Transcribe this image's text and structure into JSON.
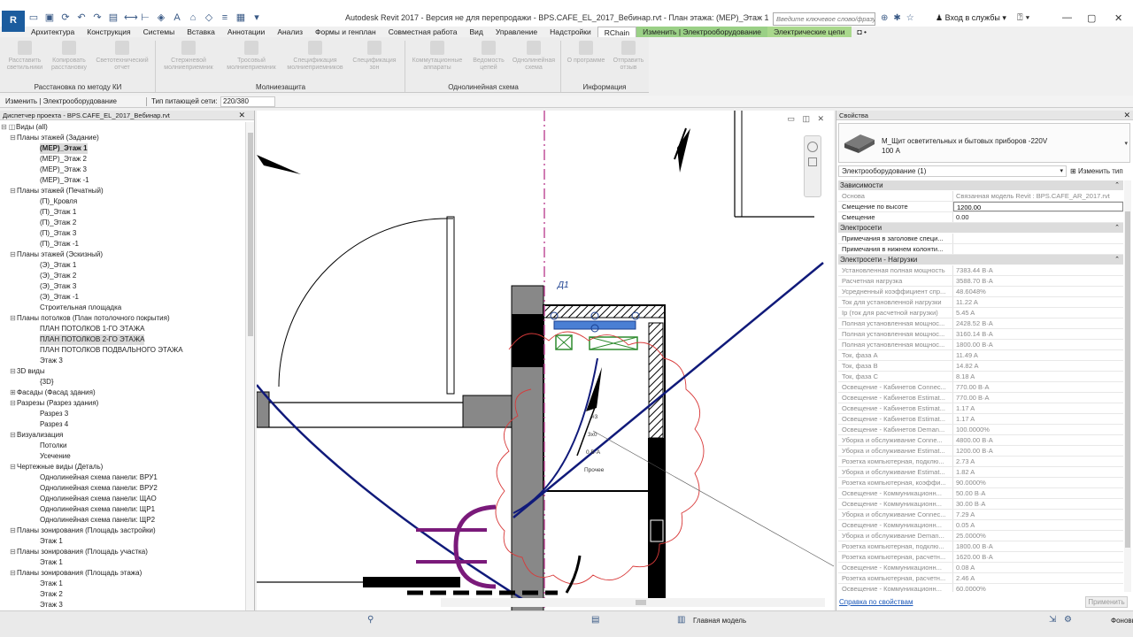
{
  "app": {
    "logo": "R",
    "title": "Autodesk Revit 2017 - Версия не для перепродажи -    BPS.CAFE_EL_2017_Вебинар.rvt - План этажа: (MEP)_Этаж 1",
    "search_placeholder": "Введите ключевое слово/фразу",
    "login": "Вход в службы",
    "quick_access_icons": [
      "open-icon",
      "save-icon",
      "sync-icon",
      "undo-icon",
      "redo-icon",
      "print-icon",
      "measure-icon",
      "dimension-icon",
      "tag-icon",
      "text-icon",
      "3d-icon",
      "section-icon",
      "thin-lines-icon",
      "close-hidden-icon",
      "switch-windows-icon"
    ]
  },
  "tabs": [
    {
      "label": "Архитектура"
    },
    {
      "label": "Конструкция"
    },
    {
      "label": "Системы"
    },
    {
      "label": "Вставка"
    },
    {
      "label": "Аннотации"
    },
    {
      "label": "Анализ"
    },
    {
      "label": "Формы и генплан"
    },
    {
      "label": "Совместная работа"
    },
    {
      "label": "Вид"
    },
    {
      "label": "Управление"
    },
    {
      "label": "Надстройки"
    },
    {
      "label": "RChain"
    },
    {
      "label": "Изменить | Электрооборудование"
    },
    {
      "label": "Электрические цепи"
    },
    {
      "label": "◘ •"
    }
  ],
  "ribbon": {
    "buttons": [
      {
        "label": "Расставить светильники"
      },
      {
        "label": "Копировать расстановку"
      },
      {
        "label": "Светотехнический отчет"
      },
      {
        "label": "Стержневой молниеприемник"
      },
      {
        "label": "Тросовый молниеприемник"
      },
      {
        "label": "Спецификация молниеприемников"
      },
      {
        "label": "Спецификация зон"
      },
      {
        "label": "Коммутационные аппараты"
      },
      {
        "label": "Ведомость цепей"
      },
      {
        "label": "Однолинейная схема"
      },
      {
        "label": "О программе"
      },
      {
        "label": "Отправить отзыв"
      }
    ],
    "groups": [
      {
        "label": "Расстановка по методу КИ"
      },
      {
        "label": "Молниезащита"
      },
      {
        "label": "Однолинейная схема"
      },
      {
        "label": "Информация"
      }
    ]
  },
  "context_bar": {
    "mode_label": "Изменить | Электрооборудование",
    "network_label": "Тип питающей сети:",
    "network_value": "220/380"
  },
  "project_browser": {
    "title": "Диспетчер проекта - BPS.CAFE_EL_2017_Вебинар.rvt",
    "close": "✕",
    "items": [
      {
        "label": "Виды (all)"
      },
      {
        "label": "Планы этажей (Задание)"
      },
      {
        "label": "(MEP)_Этаж 1"
      },
      {
        "label": "(MEP)_Этаж 2"
      },
      {
        "label": "(MEP)_Этаж 3"
      },
      {
        "label": "(MEP)_Этаж -1"
      },
      {
        "label": "Планы этажей (Печатный)"
      },
      {
        "label": "(П)_Кровля"
      },
      {
        "label": "(П)_Этаж 1"
      },
      {
        "label": "(П)_Этаж 2"
      },
      {
        "label": "(П)_Этаж 3"
      },
      {
        "label": "(П)_Этаж -1"
      },
      {
        "label": "Планы этажей (Эскизный)"
      },
      {
        "label": "(Э)_Этаж 1"
      },
      {
        "label": "(Э)_Этаж 2"
      },
      {
        "label": "(Э)_Этаж 3"
      },
      {
        "label": "(Э)_Этаж -1"
      },
      {
        "label": "Строительная площадка"
      },
      {
        "label": "Планы потолков (План потолочного покрытия)"
      },
      {
        "label": "ПЛАН ПОТОЛКОВ 1-ГО ЭТАЖА"
      },
      {
        "label": "ПЛАН ПОТОЛКОВ 2-ГО ЭТАЖА"
      },
      {
        "label": "ПЛАН ПОТОЛКОВ ПОДВАЛЬНОГО ЭТАЖА"
      },
      {
        "label": "Этаж 3"
      },
      {
        "label": "3D виды"
      },
      {
        "label": "{3D}"
      },
      {
        "label": "Фасады (Фасад здания)"
      },
      {
        "label": "Разрезы (Разрез здания)"
      },
      {
        "label": "Разрез 3"
      },
      {
        "label": "Разрез 4"
      },
      {
        "label": "Визуализация"
      },
      {
        "label": "Потолки"
      },
      {
        "label": "Усечение"
      },
      {
        "label": "Чертежные виды (Деталь)"
      },
      {
        "label": "Однолинейная схема панели: ВРУ1"
      },
      {
        "label": "Однолинейная схема панели: ВРУ2"
      },
      {
        "label": "Однолинейная схема панели: ЩАО"
      },
      {
        "label": "Однолинейная схема панели: ЩР1"
      },
      {
        "label": "Однолинейная схема панели: ЩР2"
      },
      {
        "label": "Планы зонирования (Площадь застройки)"
      },
      {
        "label": "Этаж 1"
      },
      {
        "label": "Планы зонирования (Площадь участка)"
      },
      {
        "label": "Этаж 1"
      },
      {
        "label": "Планы зонирования (Площадь этажа)"
      },
      {
        "label": "Этаж 1"
      },
      {
        "label": "Этаж 2"
      },
      {
        "label": "Этаж 3"
      }
    ]
  },
  "canvas": {
    "tag_label": "Д1",
    "circuit_label_1": "#3",
    "circuit_label_2": "3х0",
    "circuit_label_3": "0 В·А",
    "circuit_label_4": "Прочее",
    "view_controls": "▭ ◫ ✕"
  },
  "properties": {
    "title": "Свойства",
    "close": "✕",
    "type_name": "М_Щит осветительных и бытовых приборов -220V",
    "type_subname": "100 А",
    "filter": "Электрооборудование (1)",
    "edit_type": "Изменить тип",
    "sections": [
      {
        "title": "Зависимости",
        "rows": [
          {
            "k": "Основа",
            "v": "Связанная модель Revit : BPS.CAFE_AR_2017.rvt",
            "ro": true
          },
          {
            "k": "Смещение по высоте",
            "v": "1200.00",
            "edit": true
          },
          {
            "k": "Смещение",
            "v": "0.00"
          }
        ]
      },
      {
        "title": "Электросети",
        "rows": [
          {
            "k": "Примечания в заголовке специ...",
            "v": ""
          },
          {
            "k": "Примечания в нижнем колонти...",
            "v": ""
          }
        ]
      },
      {
        "title": "Электросети - Нагрузки",
        "rows": [
          {
            "k": "Установленная полная мощность",
            "v": "7383.44 В·А",
            "ro": true
          },
          {
            "k": "Расчетная нагрузка",
            "v": "3588.70 В·А",
            "ro": true
          },
          {
            "k": "Усредненный коэффициент спр...",
            "v": "48.6048%",
            "ro": true
          },
          {
            "k": "Ток для установленной нагрузки",
            "v": "11.22 A",
            "ro": true
          },
          {
            "k": "Ip (ток для расчетной нагрузки)",
            "v": "5.45 A",
            "ro": true
          },
          {
            "k": "Полная установленная мощнос...",
            "v": "2428.52 В·А",
            "ro": true
          },
          {
            "k": "Полная установленная мощнос...",
            "v": "3160.14 В·А",
            "ro": true
          },
          {
            "k": "Полная установленная мощнос...",
            "v": "1800.00 В·А",
            "ro": true
          },
          {
            "k": "Ток, фаза A",
            "v": "11.49 A",
            "ro": true
          },
          {
            "k": "Ток, фаза B",
            "v": "14.82 A",
            "ro": true
          },
          {
            "k": "Ток, фаза C",
            "v": "8.18 A",
            "ro": true
          },
          {
            "k": "Освещение - Кабинетов Connec...",
            "v": "770.00 В·А",
            "ro": true
          },
          {
            "k": "Освещение - Кабинетов Estimat...",
            "v": "770.00 В·А",
            "ro": true
          },
          {
            "k": "Освещение - Кабинетов Estimat...",
            "v": "1.17 A",
            "ro": true
          },
          {
            "k": "Освещение - Кабинетов Estimat...",
            "v": "1.17 A",
            "ro": true
          },
          {
            "k": "Освещение - Кабинетов Deman...",
            "v": "100.0000%",
            "ro": true
          },
          {
            "k": "Уборка и обслуживание Conne...",
            "v": "4800.00 В·А",
            "ro": true
          },
          {
            "k": "Уборка и обслуживание Estimat...",
            "v": "1200.00 В·А",
            "ro": true
          },
          {
            "k": "Розетка компьютерная, подклю...",
            "v": "2.73 A",
            "ro": true
          },
          {
            "k": "Уборка и обслуживание Estimat...",
            "v": "1.82 A",
            "ro": true
          },
          {
            "k": "Розетка компьютерная, коэффи...",
            "v": "90.0000%",
            "ro": true
          },
          {
            "k": "Освещение - Коммуникационн...",
            "v": "50.00 В·А",
            "ro": true
          },
          {
            "k": "Освещение - Коммуникационн...",
            "v": "30.00 В·А",
            "ro": true
          },
          {
            "k": "Уборка и обслуживание Connec...",
            "v": "7.29 A",
            "ro": true
          },
          {
            "k": "Освещение - Коммуникационн...",
            "v": "0.05 A",
            "ro": true
          },
          {
            "k": "Уборка и обслуживание Deman...",
            "v": "25.0000%",
            "ro": true
          },
          {
            "k": "Розетка компьютерная, подклю...",
            "v": "1800.00 В·А",
            "ro": true
          },
          {
            "k": "Розетка компьютерная, расчетн...",
            "v": "1620.00 В·А",
            "ro": true
          },
          {
            "k": "Освещение - Коммуникационн...",
            "v": "0.08 A",
            "ro": true
          },
          {
            "k": "Розетка компьютерная, расчетн...",
            "v": "2.46 A",
            "ro": true
          },
          {
            "k": "Освещение - Коммуникационн...",
            "v": "60.0000%",
            "ro": true
          }
        ]
      }
    ],
    "help_link": "Справка по свойствам",
    "apply": "Применить"
  },
  "status": {
    "model": "Главная модель",
    "filter_count": "Фоновы"
  }
}
